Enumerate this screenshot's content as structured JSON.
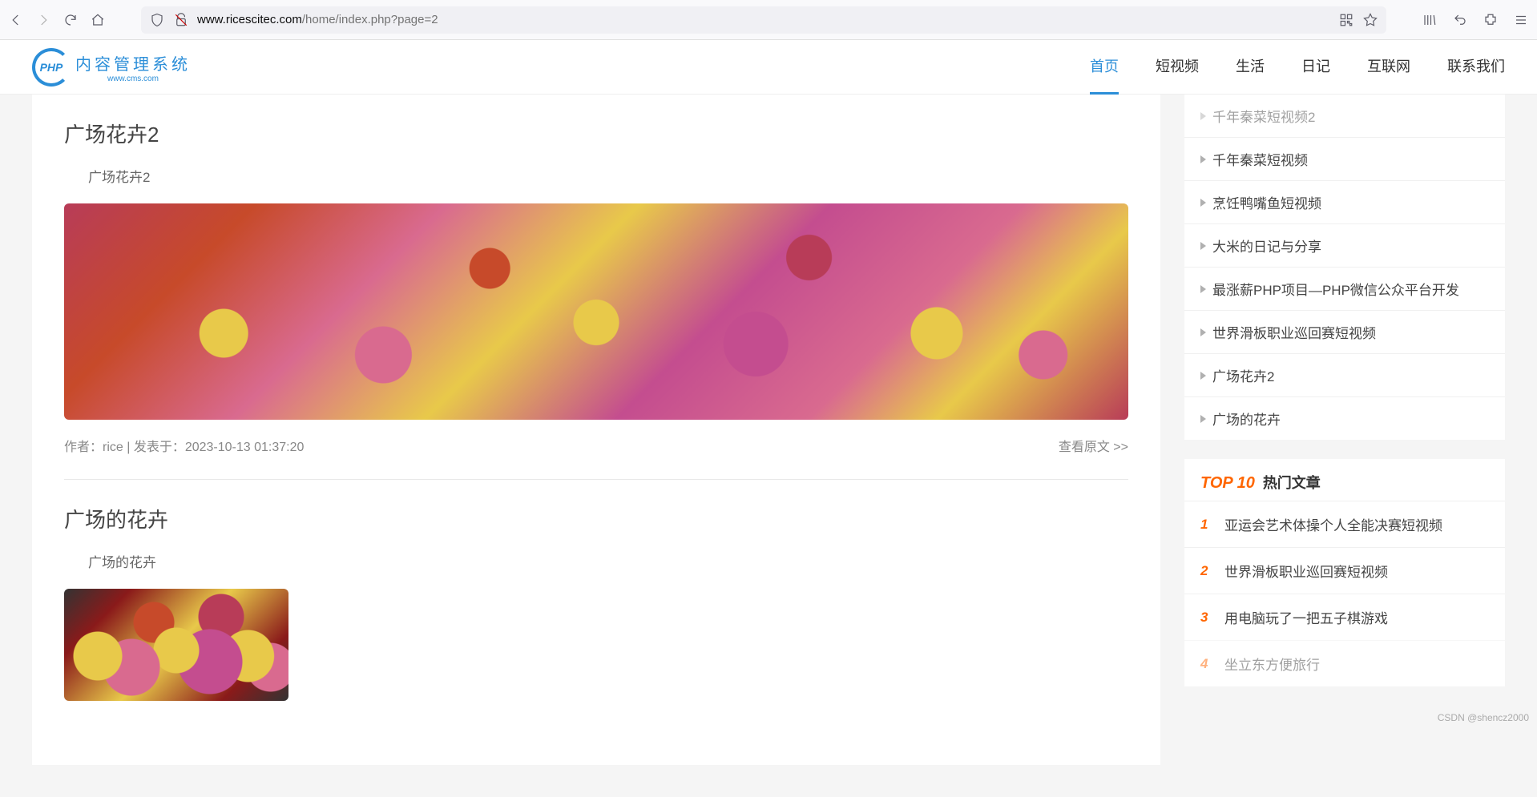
{
  "browser": {
    "url_domain": "www.ricescitec.com",
    "url_path": "/home/index.php?page=2"
  },
  "logo": {
    "badge": "PHP",
    "cn": "内容管理系统",
    "sub": "www.cms.com"
  },
  "nav": {
    "items": [
      {
        "label": "首页",
        "active": true
      },
      {
        "label": "短视频",
        "active": false
      },
      {
        "label": "生活",
        "active": false
      },
      {
        "label": "日记",
        "active": false
      },
      {
        "label": "互联网",
        "active": false
      },
      {
        "label": "联系我们",
        "active": false
      }
    ]
  },
  "articles": [
    {
      "title": "广场花卉2",
      "excerpt": "广场花卉2",
      "meta": "作者：rice | 发表于：2023-10-13 01:37:20",
      "read": "查看原文 >>"
    },
    {
      "title": "广场的花卉",
      "excerpt": "广场的花卉",
      "meta": "",
      "read": ""
    }
  ],
  "sidebar": {
    "links": [
      "千年秦菜短视频2",
      "千年秦菜短视频",
      "烹饪鸭嘴鱼短视频",
      "大米的日记与分享",
      "最涨薪PHP项目—PHP微信公众平台开发",
      "世界滑板职业巡回赛短视频",
      "广场花卉2",
      "广场的花卉"
    ],
    "top_label": "TOP 10",
    "hot_label": "热门文章",
    "hot": [
      "亚运会艺术体操个人全能决赛短视频",
      "世界滑板职业巡回赛短视频",
      "用电脑玩了一把五子棋游戏",
      "坐立东方便旅行"
    ]
  },
  "watermark": "CSDN @shencz2000"
}
